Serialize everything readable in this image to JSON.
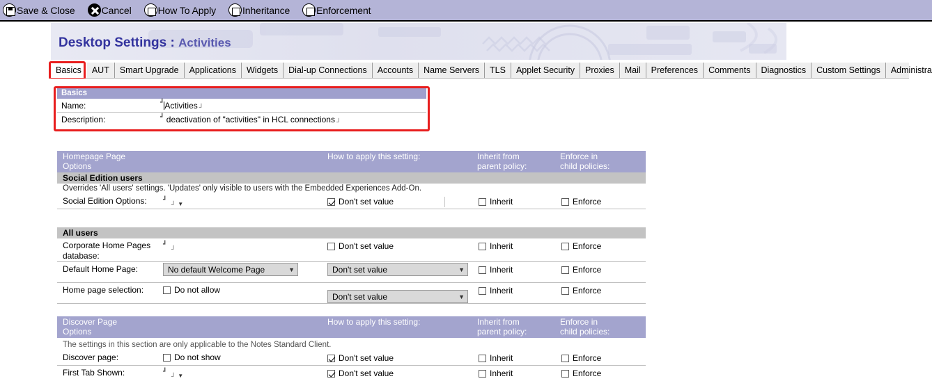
{
  "toolbar": {
    "items": [
      {
        "label": "Save & Close",
        "icon": "floppy-disk-icon"
      },
      {
        "label": "Cancel",
        "icon": "close-x-icon"
      },
      {
        "label": "How To Apply",
        "icon": "square-in-circle-icon"
      },
      {
        "label": "Inheritance",
        "icon": "square-in-circle-icon"
      },
      {
        "label": "Enforcement",
        "icon": "square-in-circle-icon"
      }
    ]
  },
  "banner": {
    "title": "Desktop Settings",
    "separator": ":",
    "subtitle": "Activities"
  },
  "tabs": [
    {
      "label": "Basics",
      "selected": true
    },
    {
      "label": "AUT",
      "selected": false
    },
    {
      "label": "Smart Upgrade",
      "selected": false
    },
    {
      "label": "Applications",
      "selected": false
    },
    {
      "label": "Widgets",
      "selected": false
    },
    {
      "label": "Dial-up Connections",
      "selected": false
    },
    {
      "label": "Accounts",
      "selected": false
    },
    {
      "label": "Name Servers",
      "selected": false
    },
    {
      "label": "TLS",
      "selected": false
    },
    {
      "label": "Applet Security",
      "selected": false
    },
    {
      "label": "Proxies",
      "selected": false
    },
    {
      "label": "Mail",
      "selected": false
    },
    {
      "label": "Preferences",
      "selected": false
    },
    {
      "label": "Comments",
      "selected": false
    },
    {
      "label": "Diagnostics",
      "selected": false
    },
    {
      "label": "Custom Settings",
      "selected": false
    },
    {
      "label": "Administration",
      "selected": false
    }
  ],
  "basics": {
    "header": "Basics",
    "name_label": "Name:",
    "name_value": "Activities",
    "description_label": "Description:",
    "description_value": "deactivation of \"activities\" in HCL connections"
  },
  "columns": {
    "how_to_apply": "How to apply this setting:",
    "inherit_from_l1": "Inherit from",
    "inherit_from_l2": "parent policy:",
    "enforce_in_l1": "Enforce in",
    "enforce_in_l2": "child policies:"
  },
  "labels": {
    "dont_set_value": "Don't set value",
    "inherit": "Inherit",
    "enforce": "Enforce"
  },
  "homepage_section": {
    "title_l1": "Homepage Page",
    "title_l2": "Options",
    "social_bar": "Social Edition users",
    "social_note": "Overrides 'All users' settings.  'Updates' only visible to users with the Embedded Experiences Add-On.",
    "social_options_label": "Social Edition Options:",
    "social_options_value": "",
    "all_users_bar": "All users",
    "corporate_label_l1": "Corporate Home Pages",
    "corporate_label_l2": "database:",
    "corporate_value": "",
    "default_home_label": "Default Home Page:",
    "default_home_value": "No default Welcome Page",
    "home_selection_label": "Home page selection:",
    "home_selection_checkbox": "Do not allow"
  },
  "discover_section": {
    "title_l1": "Discover Page",
    "title_l2": "Options",
    "note": "The settings in this section are only applicable to the Notes Standard Client.",
    "discover_label": "Discover page:",
    "discover_checkbox": "Do not show",
    "first_tab_label": "First Tab Shown:"
  },
  "colors": {
    "toolbar_bg": "#b4b4d7",
    "section_header_bg": "#a3a4ce",
    "subbar_bg": "#c3c3c3",
    "title_text": "#33339e",
    "highlight": "#e81e1e",
    "select_bg": "#d9d9d9"
  }
}
